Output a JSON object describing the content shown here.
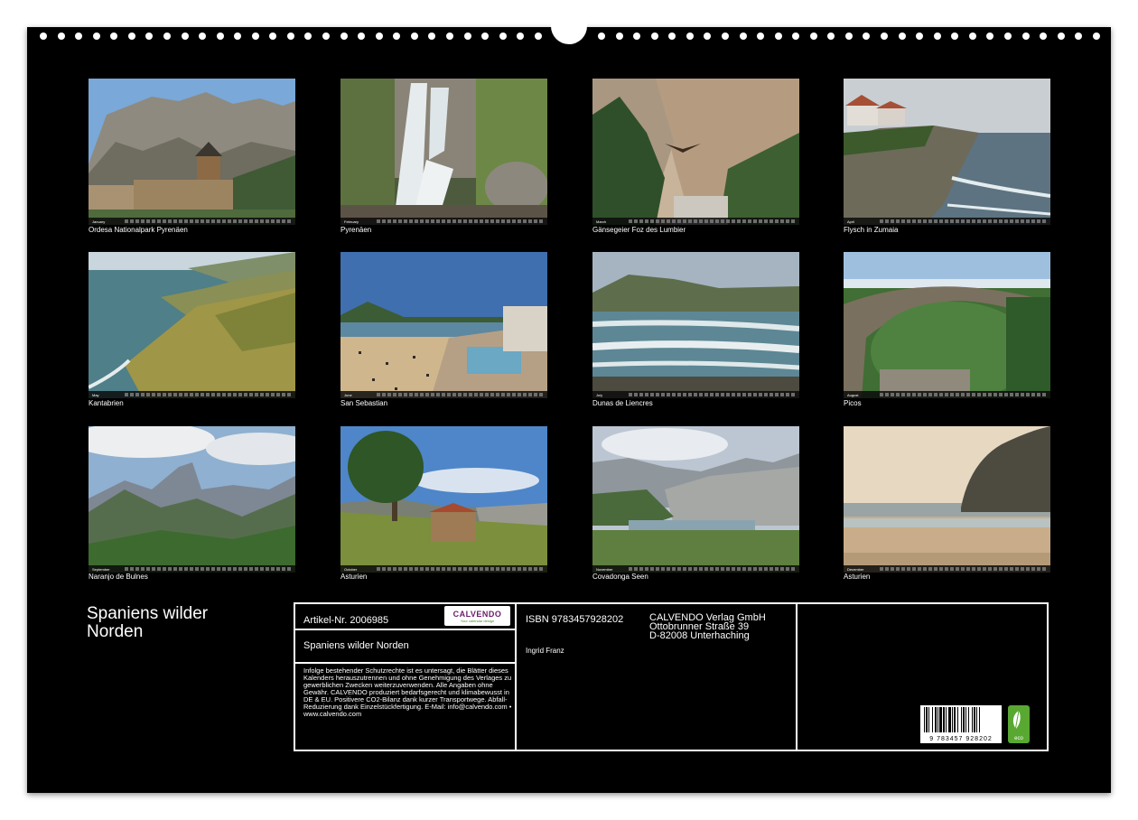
{
  "calendar": {
    "title": "Spaniens wilder Norden"
  },
  "photos": [
    {
      "month": "January",
      "caption": "Ordesa Nationalpark Pyrenäen"
    },
    {
      "month": "February",
      "caption": "Pyrenäen"
    },
    {
      "month": "March",
      "caption": "Gänsegeier Foz des Lumbier"
    },
    {
      "month": "April",
      "caption": "Flysch in Zumaia"
    },
    {
      "month": "May",
      "caption": "Kantabrien"
    },
    {
      "month": "June",
      "caption": "San Sebastian"
    },
    {
      "month": "July",
      "caption": "Dunas de Liencres"
    },
    {
      "month": "August",
      "caption": "Picos"
    },
    {
      "month": "September",
      "caption": "Naranjo de Bulnes"
    },
    {
      "month": "October",
      "caption": "Asturien"
    },
    {
      "month": "November",
      "caption": "Covadonga Seen"
    },
    {
      "month": "December",
      "caption": "Asturien"
    }
  ],
  "info": {
    "article_number": "Artikel-Nr. 2006985",
    "product_title": "Spaniens wilder Norden",
    "legal_text": "Infolge bestehender Schutzrechte ist es untersagt, die Blätter dieses Kalenders herauszutrennen und ohne Genehmigung des Verlages zu gewerblichen Zwecken weiterzuverwenden. Alle Angaben ohne Gewähr. CALVENDO produziert bedarfsgerecht und klimabewusst in DE & EU. Positivere CO2-Bilanz dank kurzer Transportwege. Abfall-Reduzierung dank Einzelstückfertigung. E-Mail: info@calvendo.com • www.calvendo.com",
    "isbn": "ISBN 9783457928202",
    "author": "Ingrid Franz",
    "publisher_lines": [
      "CALVENDO Verlag GmbH",
      "Ottobrunner Straße 39",
      "D-82008 Unterhaching"
    ],
    "barcode_number": "9 783457 928202",
    "logo_text": "CALVENDO",
    "logo_subtext": "Your calendar design",
    "eco_label": "eco"
  },
  "colors": {
    "background": "#000000",
    "text": "#ffffff",
    "eco_green": "#59a832",
    "logo_purple": "#6a1d6b"
  }
}
